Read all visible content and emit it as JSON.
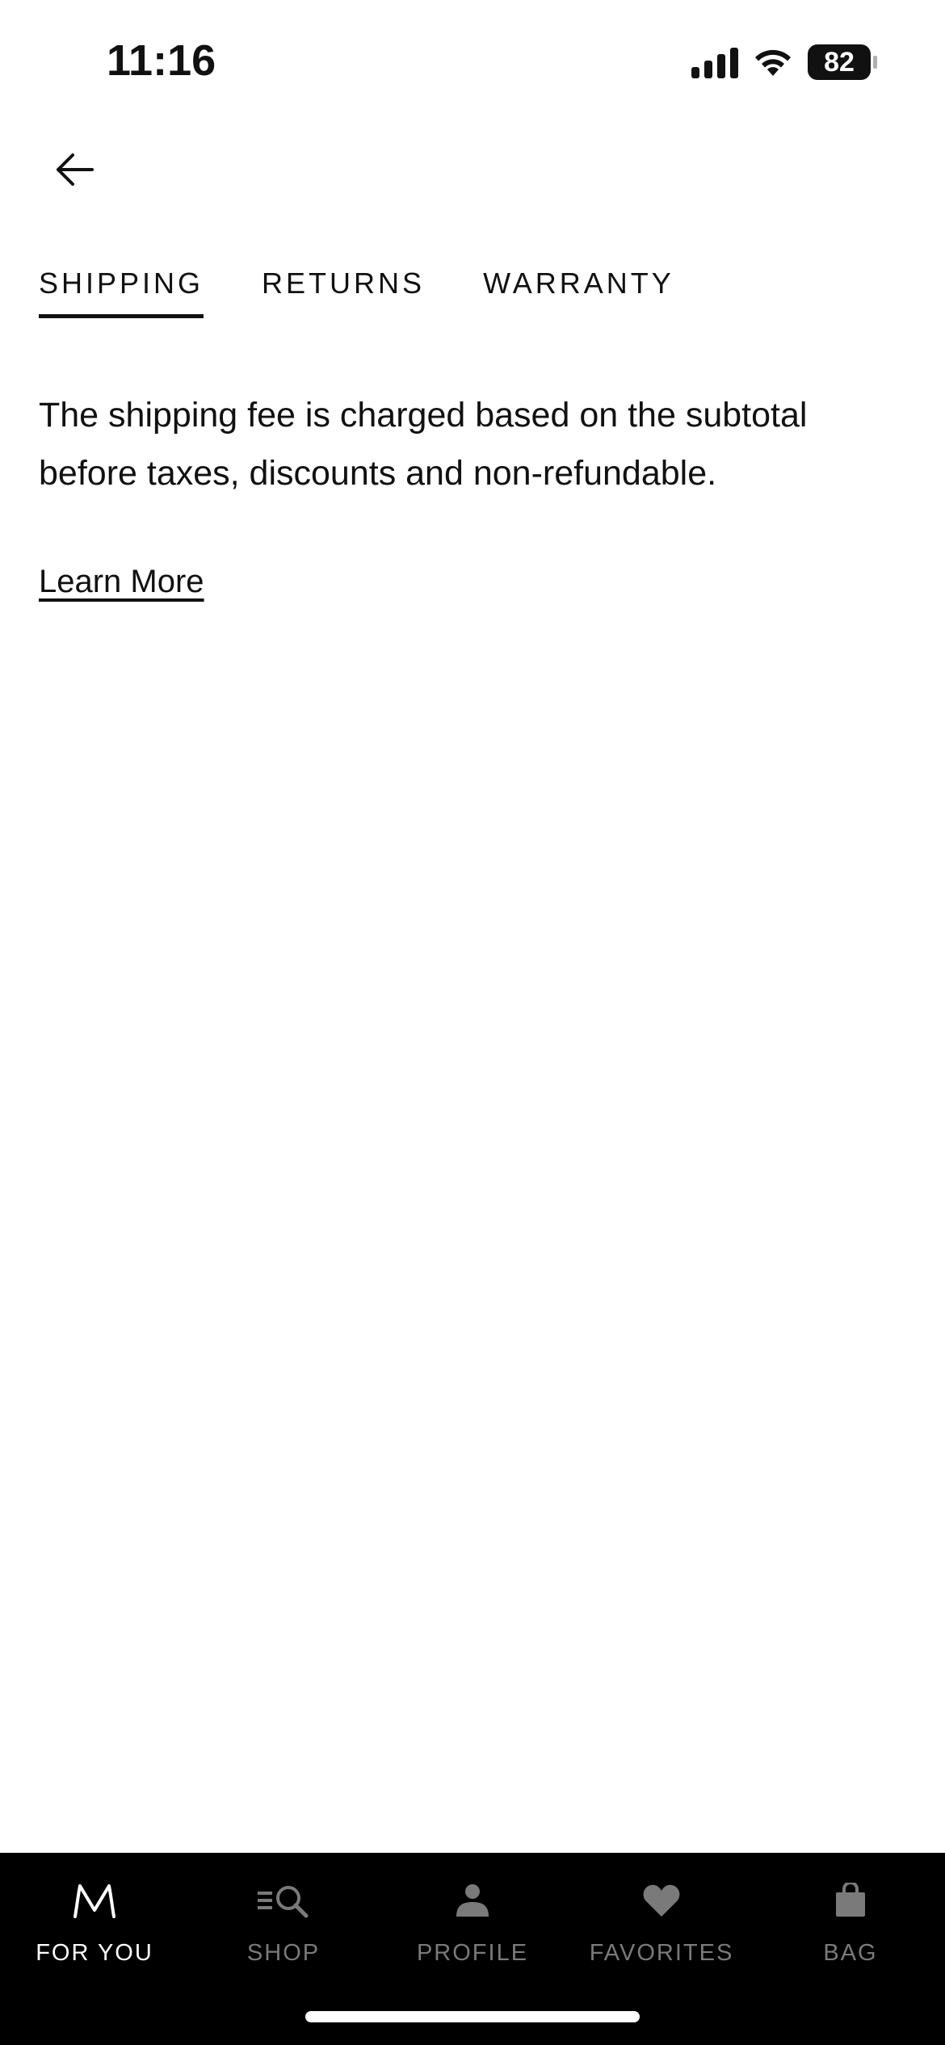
{
  "status_bar": {
    "time": "11:16",
    "battery": "82"
  },
  "header": {
    "back_icon": "arrow-left-icon"
  },
  "tabs": [
    {
      "label": "SHIPPING",
      "active": true
    },
    {
      "label": "RETURNS",
      "active": false
    },
    {
      "label": "WARRANTY",
      "active": false
    }
  ],
  "content": {
    "description": "The shipping fee is charged based on the subtotal before taxes, discounts and non-refundable.",
    "link_label": "Learn More"
  },
  "bottom_nav": {
    "items": [
      {
        "label": "FOR YOU",
        "icon": "m-logo-icon",
        "active": true
      },
      {
        "label": "SHOP",
        "icon": "shop-search-icon",
        "active": false
      },
      {
        "label": "PROFILE",
        "icon": "profile-icon",
        "active": false
      },
      {
        "label": "FAVORITES",
        "icon": "heart-icon",
        "active": false
      },
      {
        "label": "BAG",
        "icon": "bag-icon",
        "active": false
      }
    ]
  },
  "colors": {
    "text": "#111111",
    "nav_background": "#000000",
    "nav_inactive": "#7a7a7a",
    "nav_active": "#ffffff"
  }
}
